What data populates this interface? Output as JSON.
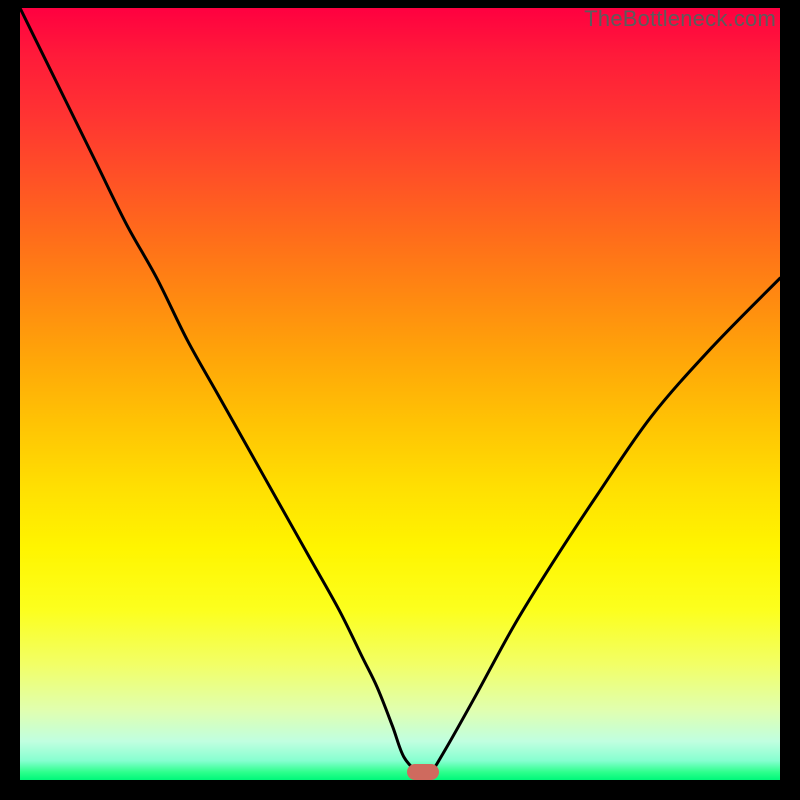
{
  "watermark": "TheBottleneck.com",
  "chart_data": {
    "type": "line",
    "title": "",
    "xlabel": "",
    "ylabel": "",
    "xlim": [
      0,
      100
    ],
    "ylim": [
      0,
      100
    ],
    "grid": false,
    "series": [
      {
        "name": "bottleneck-curve",
        "x": [
          0,
          3,
          6,
          10,
          14,
          18,
          22,
          26,
          30,
          34,
          38,
          42,
          45,
          47,
          49,
          50.5,
          52.5,
          54,
          56,
          60,
          65,
          70,
          76,
          83,
          91,
          100
        ],
        "values": [
          100,
          94,
          88,
          80,
          72,
          65,
          57,
          50,
          43,
          36,
          29,
          22,
          16,
          12,
          7,
          3,
          1,
          1,
          4,
          11,
          20,
          28,
          37,
          47,
          56,
          65
        ]
      }
    ],
    "marker": {
      "x": 53,
      "y": 1,
      "color": "#cf6a5e"
    },
    "background_gradient": {
      "top": "#ff0040",
      "bottom": "#00f87a",
      "direction": "vertical"
    }
  }
}
